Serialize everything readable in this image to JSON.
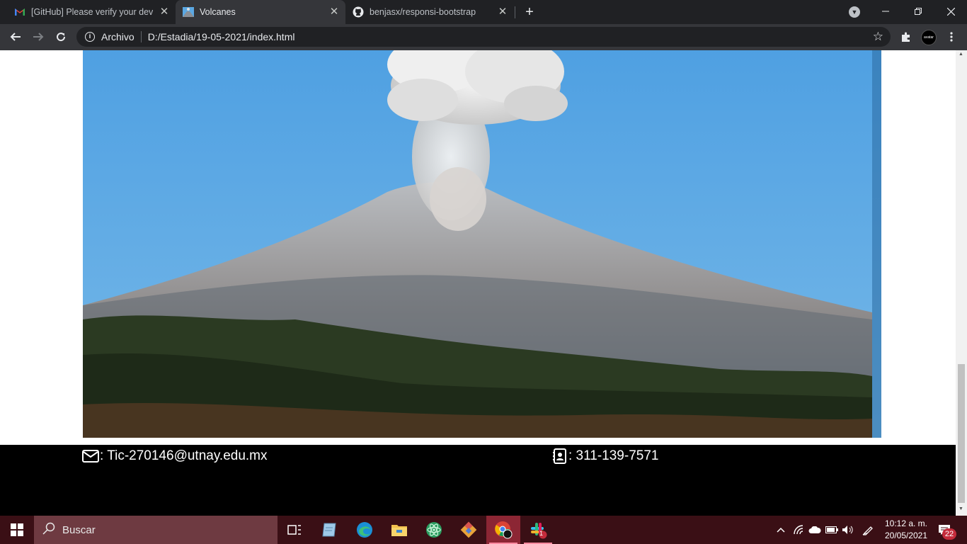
{
  "tabs": [
    {
      "title": "[GitHub] Please verify your device",
      "favicon": "gmail-icon",
      "active": false
    },
    {
      "title": "Volcanes",
      "favicon": "volcano-icon",
      "active": true
    },
    {
      "title": "benjasx/responsi-bootstrap",
      "favicon": "github-icon",
      "active": false
    }
  ],
  "toolbar": {
    "security_label": "Archivo",
    "url": "D:/Estadia/19-05-2021/index.html"
  },
  "page": {
    "hero_image": "volcano-eruption-photo",
    "footer": {
      "email": ": Tic-270146@utnay.edu.mx",
      "phone": ": 311-139-7571"
    }
  },
  "taskbar": {
    "search_placeholder": "Buscar",
    "time": "10:12 a. m.",
    "date": "20/05/2021",
    "notification_count": "22",
    "slack_badge": "1"
  },
  "colors": {
    "tabstrip": "#202124",
    "toolbar": "#35363a",
    "footer_bg": "#000000",
    "taskbar": "#3a0f15",
    "accent": "#c42b3b"
  }
}
